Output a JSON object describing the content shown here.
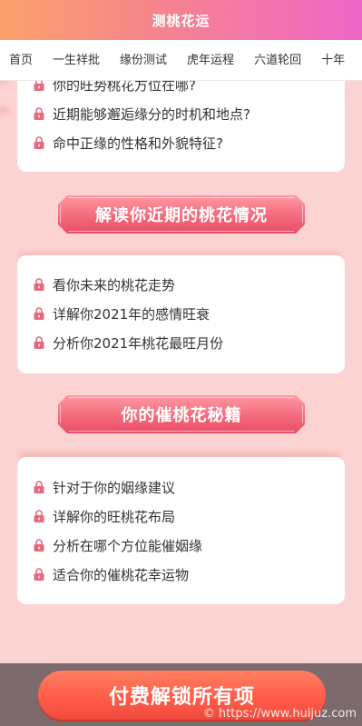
{
  "header": {
    "title": "测桃花运"
  },
  "nav": {
    "items": [
      "首页",
      "一生祥批",
      "缘份测试",
      "虎年运程",
      "六道轮回",
      "十年"
    ]
  },
  "sections": [
    {
      "items": [
        "你的旺势桃花方位在哪?",
        "近期能够邂逅缘分的时机和地点?",
        "命中正缘的性格和外貌特征?"
      ]
    },
    {
      "title": "解读你近期的桃花情况",
      "items": [
        "看你未来的桃花走势",
        "详解你2021年的感情旺衰",
        "分析你2021年桃花最旺月份"
      ]
    },
    {
      "title": "你的催桃花秘籍",
      "items": [
        "针对于你的姻缘建议",
        "详解你的旺桃花布局",
        "分析在哪个方位能催姻缘",
        "适合你的催桃花幸运物"
      ]
    }
  ],
  "footer": {
    "pay_label": "付费解锁所有项",
    "watermark": "© https://www.huijuz.com"
  },
  "colors": {
    "background": "#fcd3d3",
    "lock_icon": "#e9677b",
    "banner": "#f46a7c",
    "pay_button": "#ff5a48"
  }
}
